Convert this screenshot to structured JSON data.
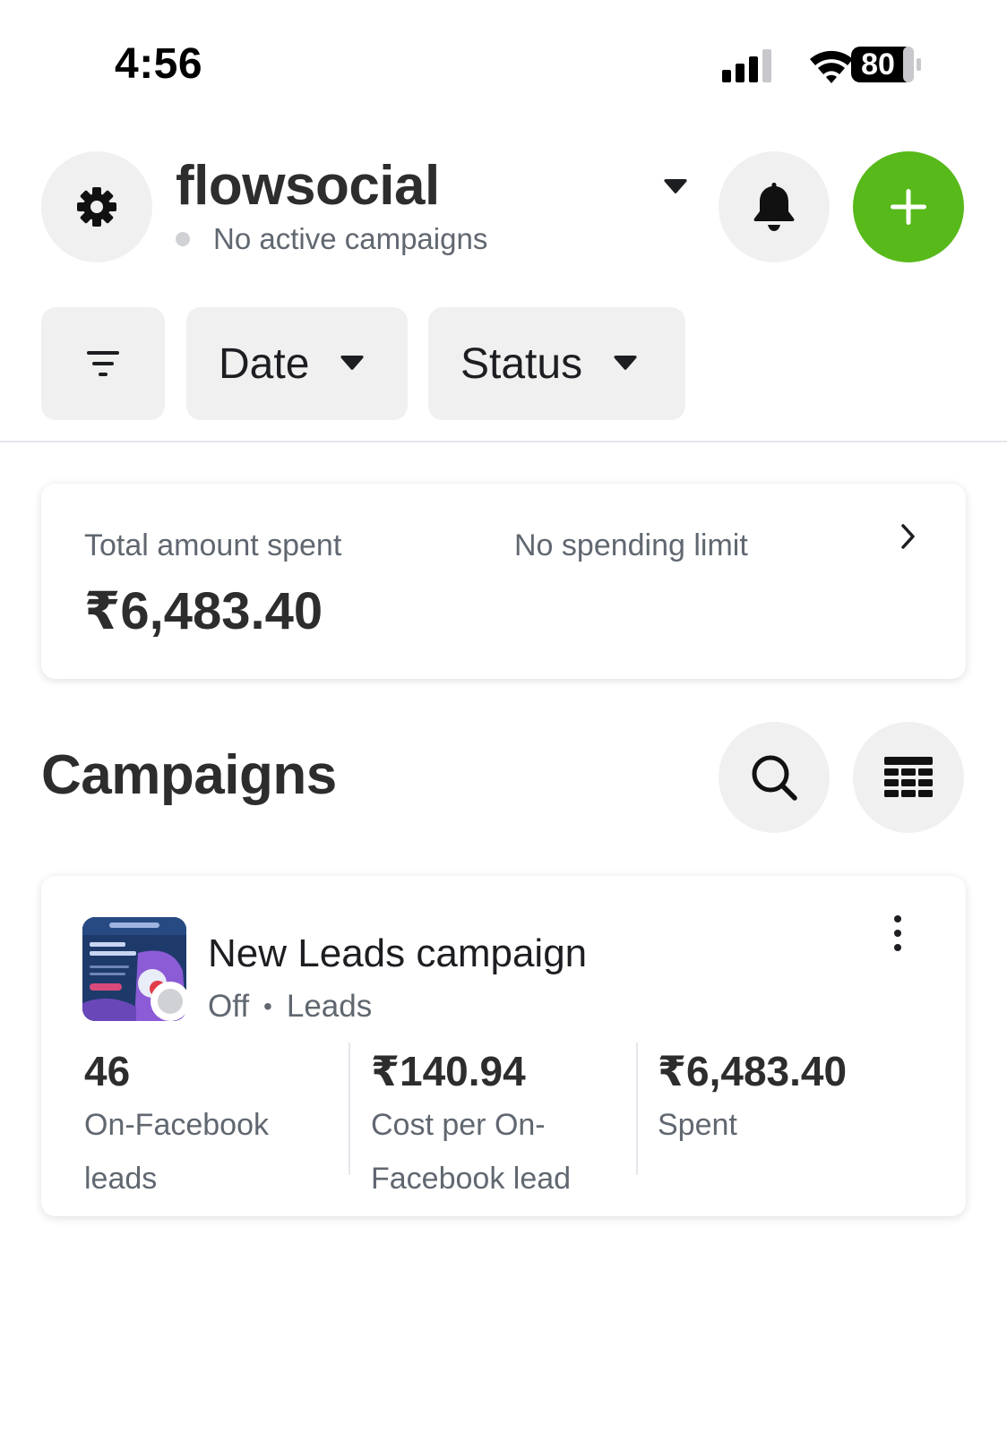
{
  "status_bar": {
    "time": "4:56",
    "battery": "80",
    "icons": [
      "signal-icon",
      "wifi-icon",
      "battery-icon"
    ]
  },
  "header": {
    "account_name": "flowsocial",
    "account_status": "No active campaigns",
    "icons": [
      "gear-icon",
      "caret-down-icon",
      "bell-icon",
      "plus-icon"
    ],
    "accent_color": "#58b91a"
  },
  "filters": {
    "date_label": "Date",
    "status_label": "Status"
  },
  "summary": {
    "spent_label": "Total amount spent",
    "spent_value": "₹6,483.40",
    "limit_label": "No spending limit"
  },
  "campaigns": {
    "title": "Campaigns",
    "items": [
      {
        "name": "New Leads campaign",
        "status": "Off",
        "objective": "Leads",
        "metrics": [
          {
            "value": "46",
            "label": "On-Facebook leads"
          },
          {
            "value": "₹140.94",
            "label": "Cost per On-Facebook lead"
          },
          {
            "value": "₹6,483.40",
            "label": "Spent"
          }
        ]
      }
    ]
  }
}
